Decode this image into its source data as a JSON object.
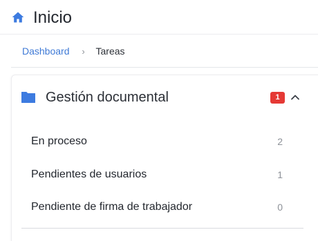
{
  "header": {
    "title": "Inicio",
    "icon": "home-icon"
  },
  "breadcrumb": {
    "items": [
      "Dashboard",
      "Tareas"
    ],
    "separator": "›"
  },
  "panel": {
    "title": "Gestión documental",
    "badge": "1",
    "icon": "folder-icon",
    "expanded": true,
    "items": [
      {
        "label": "En proceso",
        "count": "2"
      },
      {
        "label": "Pendientes de usuarios",
        "count": "1"
      },
      {
        "label": "Pendiente de firma de trabajador",
        "count": "0"
      }
    ]
  },
  "colors": {
    "accent": "#3f7ad6",
    "icon_blue": "#3d7be0",
    "badge": "#e53935"
  }
}
